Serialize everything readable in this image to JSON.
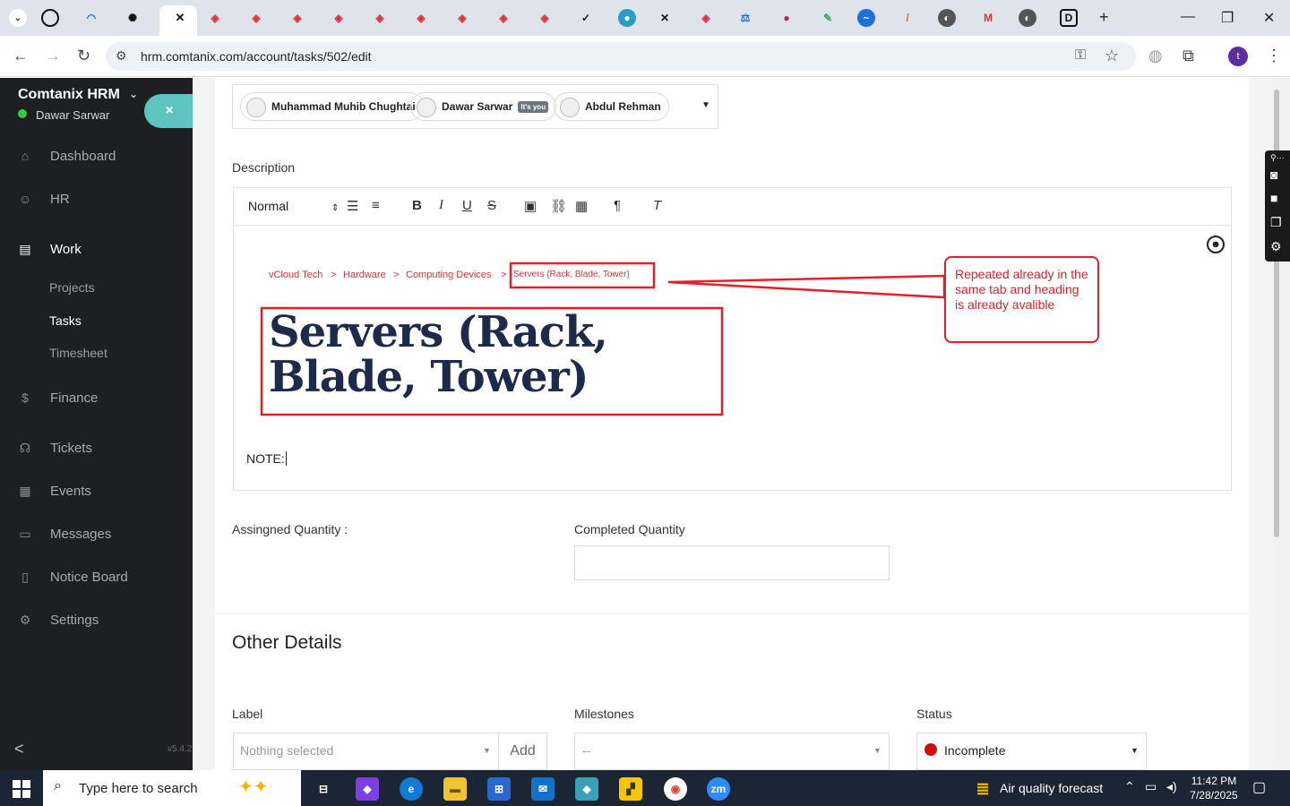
{
  "browser": {
    "url": "hrm.comtanix.com/account/tasks/502/edit",
    "profile_initial": "t",
    "new_tab": "+",
    "minimize": "—",
    "restore": "❐",
    "close": "✕"
  },
  "sidebar": {
    "brand": "Comtanix HRM",
    "user": "Dawar Sarwar",
    "close_label": "×",
    "items": [
      {
        "label": "Dashboard",
        "icon": "⌂"
      },
      {
        "label": "HR",
        "icon": "☺"
      },
      {
        "label": "Work",
        "icon": "▤"
      },
      {
        "label": "Finance",
        "icon": "$"
      },
      {
        "label": "Tickets",
        "icon": "☊"
      },
      {
        "label": "Events",
        "icon": "▦"
      },
      {
        "label": "Messages",
        "icon": "▭"
      },
      {
        "label": "Notice Board",
        "icon": "▯"
      },
      {
        "label": "Settings",
        "icon": "⚙"
      }
    ],
    "work_sub": [
      "Projects",
      "Tasks",
      "Timesheet"
    ],
    "version": "v5.4.2",
    "collapse": "<"
  },
  "assignees": [
    {
      "name": "Muhammad Muhib Chughtai"
    },
    {
      "name": "Dawar Sarwar",
      "badge": "It's you"
    },
    {
      "name": "Abdul Rehman"
    }
  ],
  "description": {
    "label": "Description",
    "format": "Normal",
    "breadcrumb": [
      "vCloud Tech",
      ">",
      "Hardware",
      ">",
      "Computing Devices",
      ">",
      "Servers (Rack, Blade, Tower)"
    ],
    "heading": "Servers (Rack, Blade, Tower)",
    "callout": "Repeated already in the same tab and heading is already avalible",
    "note": "NOTE:"
  },
  "quantities": {
    "assigned_label": "Assingned Quantity :",
    "completed_label": "Completed Quantity"
  },
  "other_details": {
    "title": "Other Details",
    "label_label": "Label",
    "label_placeholder": "Nothing selected",
    "add_button": "Add",
    "milestones_label": "Milestones",
    "milestones_value": "--",
    "status_label": "Status",
    "status_value": "Incomplete",
    "status_color": "#cc1010"
  },
  "taskbar": {
    "search_placeholder": "Type here to search",
    "weather": "Air quality forecast",
    "time": "11:42 PM",
    "date": "7/28/2025"
  }
}
